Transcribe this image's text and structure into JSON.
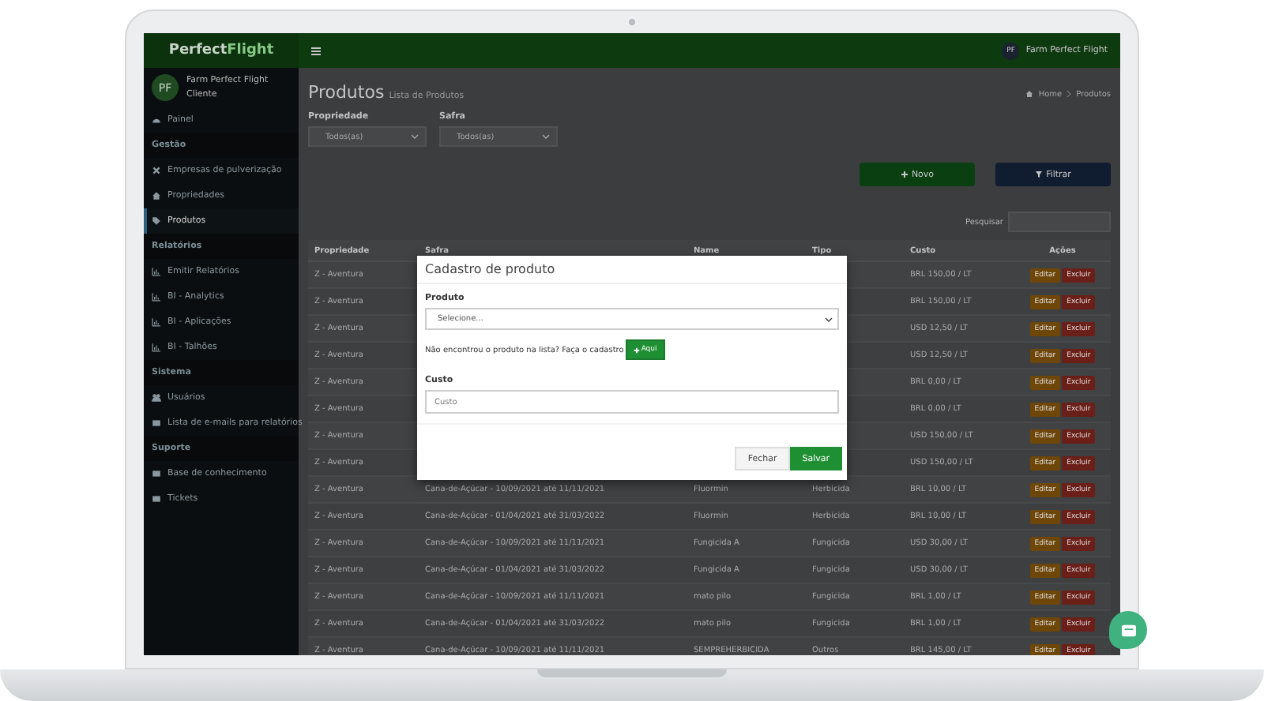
{
  "header": {
    "brand_part_1": "Perfect",
    "brand_part_2": "Flight",
    "user_avatar": "PF",
    "user_name": "Farm Perfect Flight"
  },
  "sidebar": {
    "avatar": "PF",
    "farm": "Farm Perfect Flight",
    "role": "Cliente",
    "sections": [
      {
        "items": [
          {
            "label": "Painel",
            "selected": false
          }
        ]
      },
      {
        "heading": "Gestão",
        "items": [
          {
            "label": "Empresas de pulverização",
            "selected": false
          },
          {
            "label": "Propriedades",
            "selected": false
          },
          {
            "label": "Produtos",
            "selected": true
          }
        ]
      },
      {
        "heading": "Relatórios",
        "items": [
          {
            "label": "Emitir Relatórios",
            "selected": false
          },
          {
            "label": "BI - Analytics",
            "selected": false
          },
          {
            "label": "BI - Aplicações",
            "selected": false
          },
          {
            "label": "BI - Talhões",
            "selected": false
          }
        ]
      },
      {
        "heading": "Sistema",
        "items": [
          {
            "label": "Usuários",
            "selected": false
          },
          {
            "label": "Lista de e-mails para relatórios",
            "selected": false
          }
        ]
      },
      {
        "heading": "Suporte",
        "items": [
          {
            "label": "Base de conhecimento",
            "selected": false
          },
          {
            "label": "Tickets",
            "selected": false
          }
        ]
      }
    ]
  },
  "page": {
    "title": "Produtos",
    "subtitle": "Lista de Produtos",
    "breadcrumb": [
      "Home",
      "Produtos"
    ],
    "filters": [
      {
        "label": "Propriedade",
        "value": "Todos(as)"
      },
      {
        "label": "Safra",
        "value": "Todos(as)"
      }
    ],
    "new_button": "Novo",
    "filter_button": "Filtrar",
    "search_label": "Pesquisar"
  },
  "table": {
    "columns": [
      "Propriedade",
      "Safra",
      "Name",
      "Tipo",
      "Custo",
      "Ações"
    ],
    "rows": [
      {
        "propriedade": "Z - Aventura",
        "custo": "BRL 150,00 / LT",
        "edit": "Editar",
        "delete": "Excluir"
      },
      {
        "propriedade": "Z - Aventura",
        "custo": "BRL 150,00 / LT",
        "edit": "Editar",
        "delete": "Excluir"
      },
      {
        "propriedade": "Z - Aventura",
        "custo": "USD 12,50 / LT",
        "edit": "Editar",
        "delete": "Excluir"
      },
      {
        "propriedade": "Z - Aventura",
        "custo": "USD 12,50 / LT",
        "edit": "Editar",
        "delete": "Excluir"
      },
      {
        "propriedade": "Z - Aventura",
        "custo": "BRL 0,00 / LT",
        "edit": "Editar",
        "delete": "Excluir"
      },
      {
        "propriedade": "Z - Aventura",
        "custo": "BRL 0,00 / LT",
        "edit": "Editar",
        "delete": "Excluir"
      },
      {
        "propriedade": "Z - Aventura",
        "custo": "USD 150,00 / LT",
        "edit": "Editar",
        "delete": "Excluir"
      },
      {
        "propriedade": "Z - Aventura",
        "custo": "USD 150,00 / LT",
        "edit": "Editar",
        "delete": "Excluir"
      },
      {
        "propriedade": "Z - Aventura",
        "safra": "Cana-de-Açúcar - 10/09/2021 até 11/11/2021",
        "name": "Fluormin",
        "tipo": "Herbicida",
        "custo": "BRL 10,00 / LT",
        "edit": "Editar",
        "delete": "Excluir"
      },
      {
        "propriedade": "Z - Aventura",
        "safra": "Cana-de-Açúcar - 01/04/2021 até 31/03/2022",
        "name": "Fluormin",
        "tipo": "Herbicida",
        "custo": "BRL 10,00 / LT",
        "edit": "Editar",
        "delete": "Excluir"
      },
      {
        "propriedade": "Z - Aventura",
        "safra": "Cana-de-Açúcar - 10/09/2021 até 11/11/2021",
        "name": "Fungicida A",
        "tipo": "Fungicida",
        "custo": "USD 30,00 / LT",
        "edit": "Editar",
        "delete": "Excluir"
      },
      {
        "propriedade": "Z - Aventura",
        "safra": "Cana-de-Açúcar - 01/04/2021 até 31/03/2022",
        "name": "Fungicida A",
        "tipo": "Fungicida",
        "custo": "USD 30,00 / LT",
        "edit": "Editar",
        "delete": "Excluir"
      },
      {
        "propriedade": "Z - Aventura",
        "safra": "Cana-de-Açúcar - 10/09/2021 até 11/11/2021",
        "name": "mato pilo",
        "tipo": "Fungicida",
        "custo": "BRL 1,00 / LT",
        "edit": "Editar",
        "delete": "Excluir"
      },
      {
        "propriedade": "Z - Aventura",
        "safra": "Cana-de-Açúcar - 01/04/2021 até 31/03/2022",
        "name": "mato pilo",
        "tipo": "Fungicida",
        "custo": "BRL 1,00 / LT",
        "edit": "Editar",
        "delete": "Excluir"
      },
      {
        "propriedade": "Z - Aventura",
        "safra": "Cana-de-Açúcar - 10/09/2021 até 11/11/2021",
        "name": "SEMPREHERBICIDA",
        "tipo": "Outros",
        "custo": "BRL 145,00 / LT",
        "edit": "Editar",
        "delete": "Excluir"
      }
    ]
  },
  "modal": {
    "title": "Cadastro de produto",
    "product_label": "Produto",
    "product_placeholder": "Selecione...",
    "hint": "Não encontrou o produto na lista? Faça o cadastro",
    "add_button": "Aqui",
    "cost_label": "Custo",
    "cost_placeholder": "Custo",
    "close_button": "Fechar",
    "save_button": "Salvar"
  }
}
